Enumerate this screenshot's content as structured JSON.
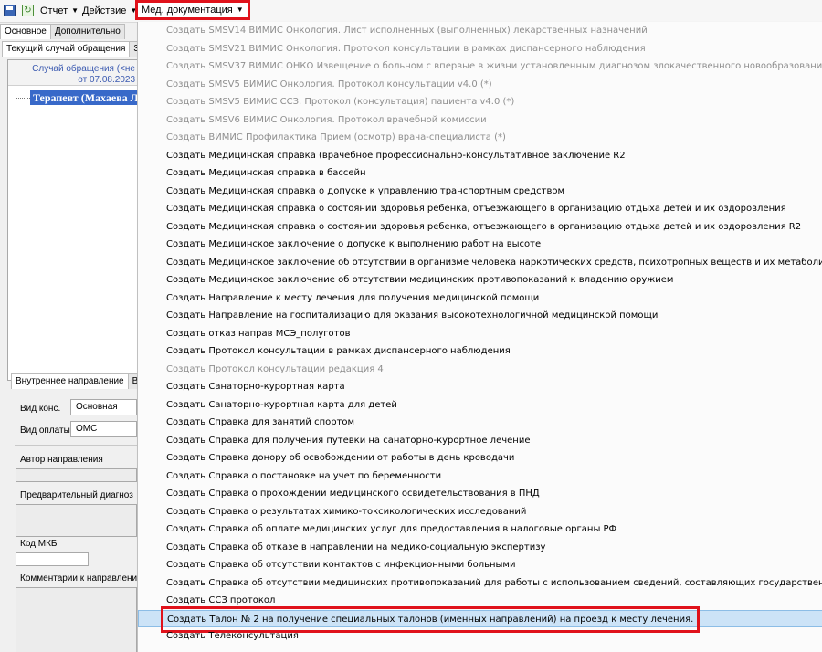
{
  "menubar": {
    "report_label": "Отчет",
    "action_label": "Действие",
    "med_docs_label": "Мед. документация",
    "highlight_color": "#e0121b"
  },
  "left_panel": {
    "tabs": [
      "Основное",
      "Дополнительно"
    ],
    "case_tab": "Текущий случай обращения",
    "case_header_line1": "Случай обращения (<не",
    "case_header_line2": "от 07.08.2023",
    "tree_selected": "Терапевт (Махаева Л.С.",
    "lower_tabs": [
      "Внутреннее направление",
      "Вн"
    ],
    "kind_label": "Вид конс.",
    "kind_value": "Основная",
    "pay_label": "Вид оплаты",
    "pay_value": "ОМС",
    "author_label": "Автор направления",
    "prelim_label": "Предварительный диагноз",
    "mkb_label": "Код МКБ",
    "comments_label": "Комментарии к направлени"
  },
  "menu": {
    "items": [
      {
        "label": "Создать SMSV14 ВИМИС Онкология. Лист исполненных (выполненных) лекарственных назначений",
        "disabled": true
      },
      {
        "label": "Создать SMSV21 ВИМИС Онкология. Протокол консультации в рамках диспансерного наблюдения",
        "disabled": true
      },
      {
        "label": "Создать SMSV37 ВИМИС ОНКО Извещение о больном с впервые в жизни установленным диагнозом злокачественного новообразования",
        "disabled": true
      },
      {
        "label": "Создать SMSV5 ВИМИС Онкология. Протокол консультации v4.0 (*)",
        "disabled": true
      },
      {
        "label": "Создать SMSV5 ВИМИС ССЗ. Протокол (консультация) пациента v4.0 (*)",
        "disabled": true
      },
      {
        "label": "Создать SMSV6 ВИМИС Онкология. Протокол врачебной комиссии",
        "disabled": true
      },
      {
        "label": "Создать ВИМИС Профилактика Прием (осмотр) врача-специалиста (*)",
        "disabled": true
      },
      {
        "label": "Создать Медицинская справка (врачебное профессионально-консультативное заключение R2",
        "disabled": false
      },
      {
        "label": "Создать Медицинская справка в бассейн",
        "disabled": false
      },
      {
        "label": "Создать Медицинская справка о допуске к управлению транспортным средством",
        "disabled": false
      },
      {
        "label": "Создать Медицинская справка о состоянии здоровья ребенка, отъезжающего в организацию отдыха детей и их оздоровления",
        "disabled": false
      },
      {
        "label": "Создать Медицинская справка о состоянии здоровья ребенка, отъезжающего в организацию отдыха детей и их оздоровления R2",
        "disabled": false
      },
      {
        "label": "Создать Медицинское заключение о допуске к выполнению работ на высоте",
        "disabled": false
      },
      {
        "label": "Создать Медицинское заключение об отсутствии в организме человека наркотических средств, психотропных веществ и их метаболитов",
        "disabled": false
      },
      {
        "label": "Создать Медицинское заключение об отсутствии медицинских противопоказаний к владению оружием",
        "disabled": false
      },
      {
        "label": "Создать Направление к месту лечения для получения медицинской помощи",
        "disabled": false
      },
      {
        "label": "Создать Направление на госпитализацию для оказания высокотехнологичной медицинской помощи",
        "disabled": false
      },
      {
        "label": "Создать отказ направ МСЭ_полуготов",
        "disabled": false
      },
      {
        "label": "Создать Протокол консультации в рамках диспансерного наблюдения",
        "disabled": false
      },
      {
        "label": "Создать Протокол консультации редакция 4",
        "disabled": true
      },
      {
        "label": "Создать Санаторно-курортная карта",
        "disabled": false
      },
      {
        "label": "Создать Санаторно-курортная карта для детей",
        "disabled": false
      },
      {
        "label": "Создать Справка для занятий спортом",
        "disabled": false
      },
      {
        "label": "Создать Справка для получения путевки на санаторно-курортное лечение",
        "disabled": false
      },
      {
        "label": "Создать Справка донору об освобождении от работы в день кроводачи",
        "disabled": false
      },
      {
        "label": "Создать Справка о постановке на учет по беременности",
        "disabled": false
      },
      {
        "label": "Создать Справка о прохождении медицинского освидетельствования в ПНД",
        "disabled": false
      },
      {
        "label": "Создать Справка о результатах химико-токсикологических исследований",
        "disabled": false
      },
      {
        "label": "Создать Справка об оплате медицинских услуг для предоставления в налоговые органы РФ",
        "disabled": false
      },
      {
        "label": "Создать Справка об отказе в направлении на медико-социальную экспертизу",
        "disabled": false
      },
      {
        "label": "Создать Справка об отсутствии контактов с инфекционными больными",
        "disabled": false
      },
      {
        "label": "Создать Справка об отсутствии медицинских противопоказаний для работы с использованием сведений, составляющих государственную тайну",
        "disabled": false
      },
      {
        "label": "Создать ССЗ протокол",
        "disabled": false
      },
      {
        "label": "Создать Талон № 2 на получение специальных талонов (именных направлений) на проезд к месту лечения.",
        "disabled": false,
        "hover": true,
        "highlighted": true
      },
      {
        "label": "Создать Телеконсультация",
        "disabled": false
      }
    ]
  }
}
